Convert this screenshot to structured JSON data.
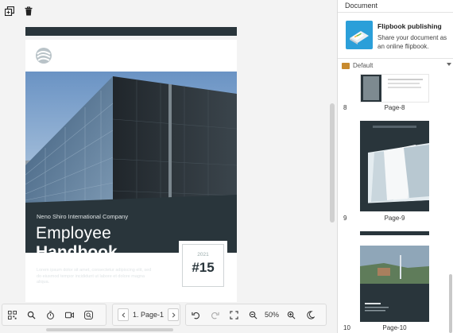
{
  "canvas": {
    "top_tools": [
      {
        "name": "duplicate-icon"
      },
      {
        "name": "trash-icon"
      }
    ],
    "page": {
      "company": "Neno Shiro International Company",
      "title_line1": "Employee",
      "title_line2": "Handbook",
      "lorem": "Lorem ipsum dolor sit amet, consectetur adipiscing elit, sed do eiusmod tempor incididunt ut labore et dolore magna aliqua.",
      "issue_year": "2021",
      "issue_number": "#15"
    }
  },
  "toolbar": {
    "pager_label": "1. Page-1",
    "zoom_label": "50%"
  },
  "panel": {
    "header": "Document",
    "promo_title": "Flipbook publishing",
    "promo_desc": "Share your document as an online flipbook.",
    "folder": "Default",
    "thumbs": [
      {
        "num": "8",
        "label": "Page-8"
      },
      {
        "num": "9",
        "label": "Page-9"
      },
      {
        "num": "10",
        "label": "Page-10"
      }
    ]
  },
  "colors": {
    "dark_slate": "#29353b",
    "accent_blue": "#2b9fd9",
    "folder": "#c88a2e"
  }
}
